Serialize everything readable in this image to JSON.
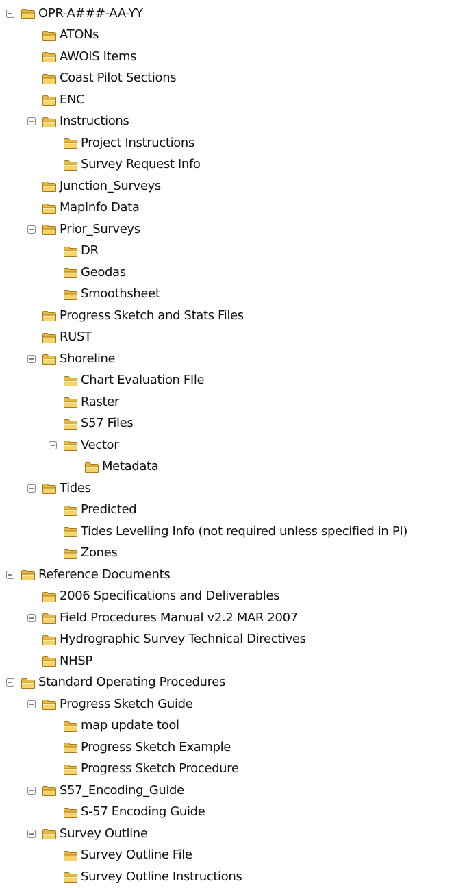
{
  "icon_names": {
    "toggle": "collapse-minus-icon",
    "folder": "folder-icon"
  },
  "colors": {
    "folder_fill": "#f5d46a",
    "folder_back": "#e9bb3d",
    "folder_stroke": "#a8781c",
    "toggle_stroke": "#8c8c8c",
    "text": "#111111"
  },
  "tree": {
    "items": [
      {
        "label": "OPR-A###-AA-YY",
        "depth": 0,
        "expanded": true
      },
      {
        "label": "ATONs",
        "depth": 1,
        "expanded": false
      },
      {
        "label": "AWOIS Items",
        "depth": 1,
        "expanded": false
      },
      {
        "label": "Coast Pilot Sections",
        "depth": 1,
        "expanded": false
      },
      {
        "label": "ENC",
        "depth": 1,
        "expanded": false
      },
      {
        "label": "Instructions",
        "depth": 1,
        "expanded": true
      },
      {
        "label": "Project Instructions",
        "depth": 2,
        "expanded": false
      },
      {
        "label": "Survey Request Info",
        "depth": 2,
        "expanded": false
      },
      {
        "label": "Junction_Surveys",
        "depth": 1,
        "expanded": false
      },
      {
        "label": "MapInfo Data",
        "depth": 1,
        "expanded": false
      },
      {
        "label": "Prior_Surveys",
        "depth": 1,
        "expanded": true
      },
      {
        "label": "DR",
        "depth": 2,
        "expanded": false
      },
      {
        "label": "Geodas",
        "depth": 2,
        "expanded": false
      },
      {
        "label": "Smoothsheet",
        "depth": 2,
        "expanded": false
      },
      {
        "label": "Progress Sketch and Stats Files",
        "depth": 1,
        "expanded": false
      },
      {
        "label": "RUST",
        "depth": 1,
        "expanded": false
      },
      {
        "label": "Shoreline",
        "depth": 1,
        "expanded": true
      },
      {
        "label": "Chart Evaluation FIle",
        "depth": 2,
        "expanded": false
      },
      {
        "label": "Raster",
        "depth": 2,
        "expanded": false
      },
      {
        "label": "S57 Files",
        "depth": 2,
        "expanded": false
      },
      {
        "label": "Vector",
        "depth": 2,
        "expanded": true
      },
      {
        "label": "Metadata",
        "depth": 3,
        "expanded": false
      },
      {
        "label": "Tides",
        "depth": 1,
        "expanded": true
      },
      {
        "label": "Predicted",
        "depth": 2,
        "expanded": false
      },
      {
        "label": "Tides Levelling Info (not required unless specified in PI)",
        "depth": 2,
        "expanded": false
      },
      {
        "label": "Zones",
        "depth": 2,
        "expanded": false
      },
      {
        "label": "Reference Documents",
        "depth": 0,
        "expanded": true
      },
      {
        "label": "2006 Specifications and Deliverables",
        "depth": 1,
        "expanded": false
      },
      {
        "label": "Field Procedures Manual v2.2 MAR 2007",
        "depth": 1,
        "expanded": true
      },
      {
        "label": "Hydrographic Survey Technical Directives",
        "depth": 1,
        "expanded": false
      },
      {
        "label": "NHSP",
        "depth": 1,
        "expanded": false
      },
      {
        "label": "Standard Operating Procedures",
        "depth": 0,
        "expanded": true
      },
      {
        "label": "Progress Sketch Guide",
        "depth": 1,
        "expanded": true
      },
      {
        "label": "map update tool",
        "depth": 2,
        "expanded": false
      },
      {
        "label": "Progress Sketch Example",
        "depth": 2,
        "expanded": false
      },
      {
        "label": "Progress Sketch Procedure",
        "depth": 2,
        "expanded": false
      },
      {
        "label": "S57_Encoding_Guide",
        "depth": 1,
        "expanded": true
      },
      {
        "label": "S-57 Encoding Guide",
        "depth": 2,
        "expanded": false
      },
      {
        "label": "Survey Outline",
        "depth": 1,
        "expanded": true
      },
      {
        "label": "Survey Outline File",
        "depth": 2,
        "expanded": false
      },
      {
        "label": "Survey Outline Instructions",
        "depth": 2,
        "expanded": false
      }
    ]
  }
}
